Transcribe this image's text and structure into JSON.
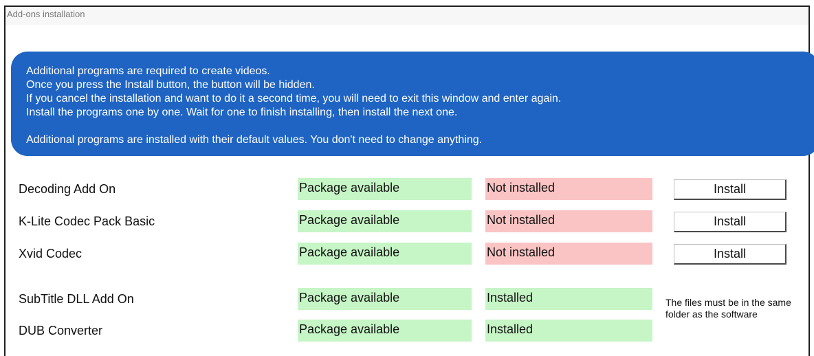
{
  "window": {
    "title": "Add-ons installation"
  },
  "info": {
    "lines": [
      "Additional programs are required to create videos.",
      "Once you press the Install button, the button will be hidden.",
      "If you cancel the installation and want to do it a second time, you will need to exit this window and enter again.",
      "Install the programs one by one. Wait for one to finish installing, then install the next one."
    ],
    "footer": "Additional programs are installed with their default values. You don't need to change anything."
  },
  "addons": [
    {
      "name": "Decoding Add On",
      "package": "Package available",
      "status": "Not installed",
      "button": "Install"
    },
    {
      "name": "K-Lite Codec Pack Basic",
      "package": "Package available",
      "status": "Not installed",
      "button": "Install"
    },
    {
      "name": "Xvid Codec",
      "package": "Package available",
      "status": "Not installed",
      "button": "Install"
    },
    {
      "name": "SubTitle DLL Add On",
      "package": "Package available",
      "status": "Installed"
    },
    {
      "name": "DUB Converter",
      "package": "Package available",
      "status": "Installed"
    }
  ],
  "note": "The files must be in the same folder as the software",
  "colors": {
    "info_background": "#1f64c3",
    "available_green": "#c6f5c6",
    "not_installed_red": "#fbc4c4"
  }
}
